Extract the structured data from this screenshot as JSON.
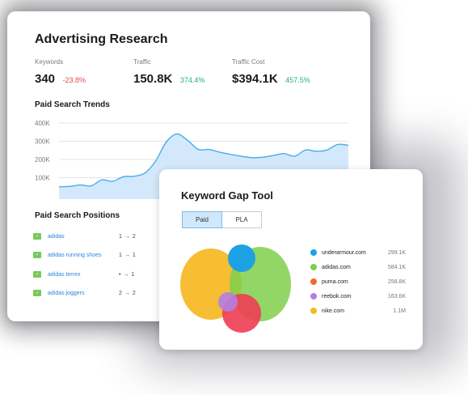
{
  "main": {
    "title": "Advertising Research",
    "metrics": [
      {
        "label": "Keywords",
        "value": "340",
        "delta": "-23.8%",
        "delta_color": "#e5484d"
      },
      {
        "label": "Traffic",
        "value": "150.8K",
        "delta": "374.4%",
        "delta_color": "#1fb37a"
      },
      {
        "label": "Traffic Cost",
        "value": "$394.1K",
        "delta": "457.5%",
        "delta_color": "#1fb37a"
      }
    ],
    "trends_title": "Paid Search Trends",
    "positions_title": "Paid Search Positions",
    "positions": [
      {
        "keyword": "adidas",
        "from": "1",
        "arrow": "→",
        "to": "2"
      },
      {
        "keyword": "adidas running shoes",
        "from": "1",
        "arrow": "→",
        "to": "1"
      },
      {
        "keyword": "adidas terrex",
        "from": "•",
        "arrow": "→",
        "to": "1"
      },
      {
        "keyword": "adidas joggers",
        "from": "2",
        "arrow": "→",
        "to": "2"
      }
    ]
  },
  "chart_data": {
    "type": "area",
    "title": "Paid Search Trends",
    "y_ticks": [
      "400K",
      "300K",
      "200K",
      "100K"
    ],
    "ylim": [
      0,
      400000
    ],
    "grid": true,
    "values": [
      50000,
      52000,
      60000,
      55000,
      88000,
      80000,
      105000,
      108000,
      125000,
      190000,
      295000,
      340000,
      305000,
      255000,
      255000,
      240000,
      228000,
      218000,
      210000,
      212000,
      222000,
      232000,
      218000,
      252000,
      245000,
      252000,
      282000,
      278000
    ]
  },
  "gap": {
    "title": "Keyword Gap Tool",
    "tabs": [
      {
        "label": "Paid",
        "active": true
      },
      {
        "label": "PLA",
        "active": false
      }
    ],
    "legend": [
      {
        "domain": "underarmour.com",
        "value": "299.1K",
        "color": "#1da1e2"
      },
      {
        "domain": "adidas.com",
        "value": "584.1K",
        "color": "#7fcf4a"
      },
      {
        "domain": "puma.com",
        "value": "258.8K",
        "color": "#f06a35"
      },
      {
        "domain": "reebok.com",
        "value": "163.6K",
        "color": "#b57ee0"
      },
      {
        "domain": "nike.com",
        "value": "1.1M",
        "color": "#f7b928"
      }
    ]
  }
}
